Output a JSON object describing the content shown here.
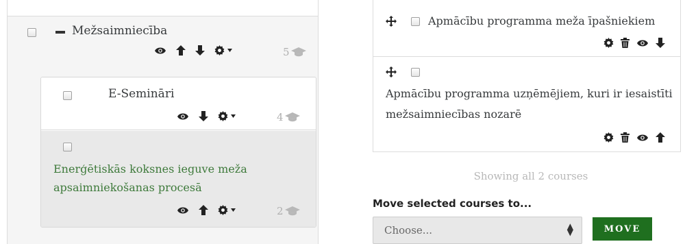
{
  "categories_panel": {
    "category": {
      "name": "Mežsaimniecība",
      "course_count": "5"
    },
    "subcategory": {
      "name": "E-Semināri",
      "course_count": "4"
    },
    "course": {
      "name": "Enerģētiskās koksnes ieguve meža apsaimniekošanas procesā",
      "course_count": "2"
    },
    "icons": [
      "eye-icon",
      "arrow-up-icon",
      "arrow-down-icon",
      "gear-icon",
      "caret-down-icon",
      "graduation-cap-icon"
    ],
    "colors": {
      "course_link": "#3e7a3b",
      "selected_bg": "#e9e9e9"
    }
  },
  "courses_panel": {
    "courses": [
      {
        "title": "Apmācību programma meža īpašniekiem"
      },
      {
        "title": "Apmācību programma uzņēmējiem, kuri ir iesaistīti mežsaimniecības nozarē"
      }
    ],
    "icons": [
      "move-icon",
      "gear-icon",
      "trash-icon",
      "eye-icon",
      "arrow-up-icon",
      "arrow-down-icon"
    ],
    "showing_text": "Showing all 2 courses",
    "move_label": "Move selected courses to...",
    "move_select": {
      "selected": "Choose..."
    },
    "move_button": "MOVE",
    "colors": {
      "move_button": "#1f6f1f"
    }
  }
}
